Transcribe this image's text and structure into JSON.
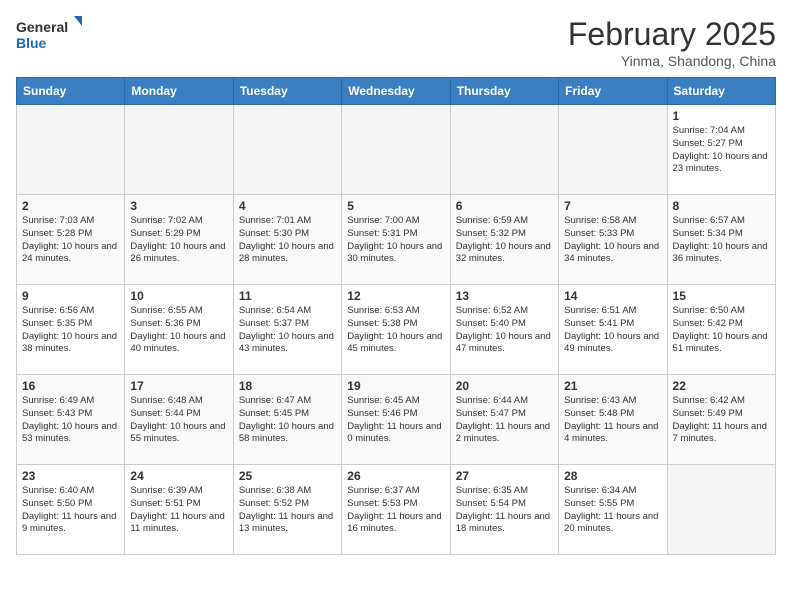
{
  "header": {
    "logo_general": "General",
    "logo_blue": "Blue",
    "month_title": "February 2025",
    "location": "Yinma, Shandong, China"
  },
  "weekdays": [
    "Sunday",
    "Monday",
    "Tuesday",
    "Wednesday",
    "Thursday",
    "Friday",
    "Saturday"
  ],
  "weeks": [
    [
      {
        "day": "",
        "info": ""
      },
      {
        "day": "",
        "info": ""
      },
      {
        "day": "",
        "info": ""
      },
      {
        "day": "",
        "info": ""
      },
      {
        "day": "",
        "info": ""
      },
      {
        "day": "",
        "info": ""
      },
      {
        "day": "1",
        "info": "Sunrise: 7:04 AM\nSunset: 5:27 PM\nDaylight: 10 hours and 23 minutes."
      }
    ],
    [
      {
        "day": "2",
        "info": "Sunrise: 7:03 AM\nSunset: 5:28 PM\nDaylight: 10 hours and 24 minutes."
      },
      {
        "day": "3",
        "info": "Sunrise: 7:02 AM\nSunset: 5:29 PM\nDaylight: 10 hours and 26 minutes."
      },
      {
        "day": "4",
        "info": "Sunrise: 7:01 AM\nSunset: 5:30 PM\nDaylight: 10 hours and 28 minutes."
      },
      {
        "day": "5",
        "info": "Sunrise: 7:00 AM\nSunset: 5:31 PM\nDaylight: 10 hours and 30 minutes."
      },
      {
        "day": "6",
        "info": "Sunrise: 6:59 AM\nSunset: 5:32 PM\nDaylight: 10 hours and 32 minutes."
      },
      {
        "day": "7",
        "info": "Sunrise: 6:58 AM\nSunset: 5:33 PM\nDaylight: 10 hours and 34 minutes."
      },
      {
        "day": "8",
        "info": "Sunrise: 6:57 AM\nSunset: 5:34 PM\nDaylight: 10 hours and 36 minutes."
      }
    ],
    [
      {
        "day": "9",
        "info": "Sunrise: 6:56 AM\nSunset: 5:35 PM\nDaylight: 10 hours and 38 minutes."
      },
      {
        "day": "10",
        "info": "Sunrise: 6:55 AM\nSunset: 5:36 PM\nDaylight: 10 hours and 40 minutes."
      },
      {
        "day": "11",
        "info": "Sunrise: 6:54 AM\nSunset: 5:37 PM\nDaylight: 10 hours and 43 minutes."
      },
      {
        "day": "12",
        "info": "Sunrise: 6:53 AM\nSunset: 5:38 PM\nDaylight: 10 hours and 45 minutes."
      },
      {
        "day": "13",
        "info": "Sunrise: 6:52 AM\nSunset: 5:40 PM\nDaylight: 10 hours and 47 minutes."
      },
      {
        "day": "14",
        "info": "Sunrise: 6:51 AM\nSunset: 5:41 PM\nDaylight: 10 hours and 49 minutes."
      },
      {
        "day": "15",
        "info": "Sunrise: 6:50 AM\nSunset: 5:42 PM\nDaylight: 10 hours and 51 minutes."
      }
    ],
    [
      {
        "day": "16",
        "info": "Sunrise: 6:49 AM\nSunset: 5:43 PM\nDaylight: 10 hours and 53 minutes."
      },
      {
        "day": "17",
        "info": "Sunrise: 6:48 AM\nSunset: 5:44 PM\nDaylight: 10 hours and 55 minutes."
      },
      {
        "day": "18",
        "info": "Sunrise: 6:47 AM\nSunset: 5:45 PM\nDaylight: 10 hours and 58 minutes."
      },
      {
        "day": "19",
        "info": "Sunrise: 6:45 AM\nSunset: 5:46 PM\nDaylight: 11 hours and 0 minutes."
      },
      {
        "day": "20",
        "info": "Sunrise: 6:44 AM\nSunset: 5:47 PM\nDaylight: 11 hours and 2 minutes."
      },
      {
        "day": "21",
        "info": "Sunrise: 6:43 AM\nSunset: 5:48 PM\nDaylight: 11 hours and 4 minutes."
      },
      {
        "day": "22",
        "info": "Sunrise: 6:42 AM\nSunset: 5:49 PM\nDaylight: 11 hours and 7 minutes."
      }
    ],
    [
      {
        "day": "23",
        "info": "Sunrise: 6:40 AM\nSunset: 5:50 PM\nDaylight: 11 hours and 9 minutes."
      },
      {
        "day": "24",
        "info": "Sunrise: 6:39 AM\nSunset: 5:51 PM\nDaylight: 11 hours and 11 minutes."
      },
      {
        "day": "25",
        "info": "Sunrise: 6:38 AM\nSunset: 5:52 PM\nDaylight: 11 hours and 13 minutes."
      },
      {
        "day": "26",
        "info": "Sunrise: 6:37 AM\nSunset: 5:53 PM\nDaylight: 11 hours and 16 minutes."
      },
      {
        "day": "27",
        "info": "Sunrise: 6:35 AM\nSunset: 5:54 PM\nDaylight: 11 hours and 18 minutes."
      },
      {
        "day": "28",
        "info": "Sunrise: 6:34 AM\nSunset: 5:55 PM\nDaylight: 11 hours and 20 minutes."
      },
      {
        "day": "",
        "info": ""
      }
    ]
  ]
}
